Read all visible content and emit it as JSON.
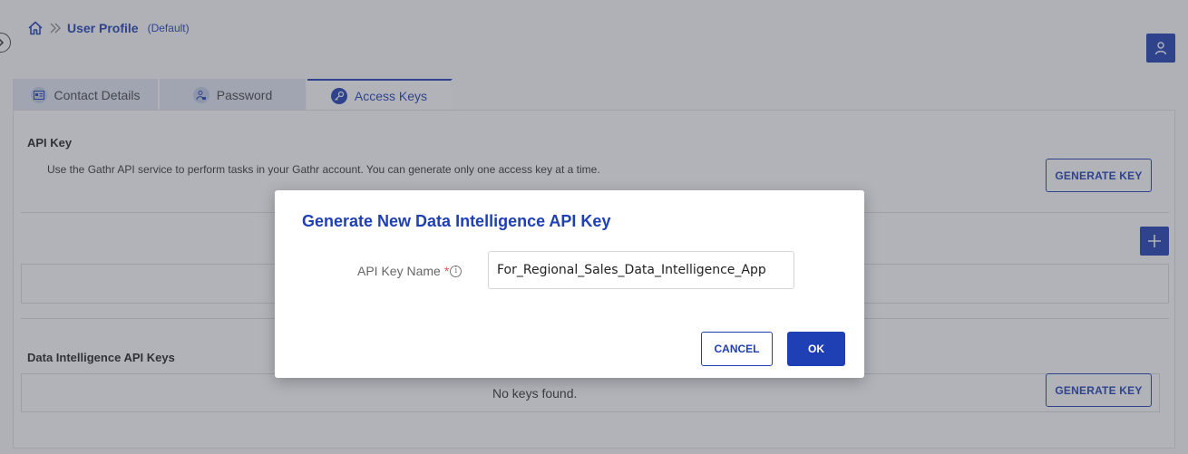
{
  "breadcrumb": {
    "home_icon": "home-icon",
    "separator_icon": "double-chevron-right-icon",
    "title": "User Profile",
    "subtitle": "(Default)"
  },
  "header": {
    "avatar_icon": "user-icon"
  },
  "tabs": [
    {
      "label": "Contact Details",
      "icon": "id-card-icon",
      "active": false
    },
    {
      "label": "Password",
      "icon": "user-lock-icon",
      "active": false
    },
    {
      "label": "Access Keys",
      "icon": "key-icon",
      "active": true
    }
  ],
  "api_key_section": {
    "title": "API Key",
    "description": "Use the Gathr API service to perform tasks in your Gathr account. You can generate only one access key at a time.",
    "generate_label": "GENERATE KEY"
  },
  "di_section": {
    "title": "Data Intelligence API Keys",
    "empty_text": "No keys found.",
    "generate_label": "GENERATE KEY"
  },
  "dialog": {
    "title": "Generate New Data Intelligence API Key",
    "field_label": "API Key Name",
    "required_mark": "*",
    "info_glyph": "i",
    "field_value": "For_Regional_Sales_Data_Intelligence_App",
    "cancel_label": "CANCEL",
    "ok_label": "OK"
  },
  "colors": {
    "primary": "#1f3fb4",
    "required": "#d9534f"
  }
}
